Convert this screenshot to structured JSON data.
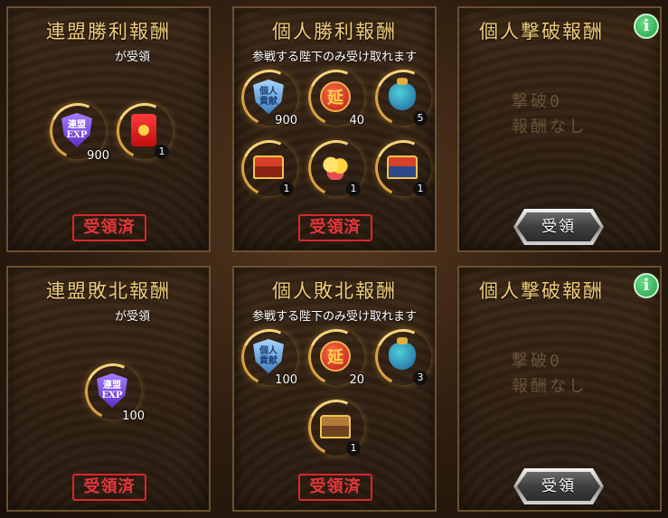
{
  "panels": {
    "alliance_win": {
      "title": "連盟勝利報酬",
      "subtitle": "が受領",
      "stamp": "受領済",
      "items": [
        {
          "icon": "alliance-exp-shield-icon",
          "label": "連盟\nEXP",
          "qty": "900"
        },
        {
          "icon": "red-envelope-icon",
          "qty": "1"
        }
      ]
    },
    "personal_win": {
      "title": "個人勝利報酬",
      "subtitle": "参戦する陛下のみ受け取れます",
      "stamp": "受領済",
      "items": [
        {
          "icon": "personal-contribution-shield-icon",
          "label": "個人\n貢献",
          "qty": "900"
        },
        {
          "icon": "red-coin-icon",
          "qty": "40"
        },
        {
          "icon": "blue-bag-icon",
          "qty": "5"
        },
        {
          "icon": "red-chest-icon",
          "qty": "1"
        },
        {
          "icon": "gold-ingots-icon",
          "qty": "1"
        },
        {
          "icon": "blue-chest-icon",
          "qty": "1"
        }
      ]
    },
    "personal_defeat_top": {
      "title": "個人撃破報酬",
      "empty_line1": "撃破0",
      "empty_line2": "報酬なし",
      "button": "受領"
    },
    "alliance_loss": {
      "title": "連盟敗北報酬",
      "subtitle": "が受領",
      "stamp": "受領済",
      "items": [
        {
          "icon": "alliance-exp-shield-icon",
          "label": "連盟\nEXP",
          "qty": "100"
        }
      ]
    },
    "personal_loss": {
      "title": "個人敗北報酬",
      "subtitle": "参戦する陛下のみ受け取れます",
      "stamp": "受領済",
      "items": [
        {
          "icon": "personal-contribution-shield-icon",
          "label": "個人\n貢献",
          "qty": "100"
        },
        {
          "icon": "red-coin-icon",
          "qty": "20"
        },
        {
          "icon": "blue-bag-icon",
          "qty": "3"
        },
        {
          "icon": "brown-chest-icon",
          "qty": "1"
        }
      ]
    },
    "personal_defeat_bottom": {
      "title": "個人撃破報酬",
      "empty_line1": "撃破0",
      "empty_line2": "報酬なし",
      "button": "受領"
    }
  },
  "colors": {
    "title": "#f0cc7a",
    "stamp": "#e8353a",
    "info": "#1f9c45"
  },
  "info_icon": "i"
}
